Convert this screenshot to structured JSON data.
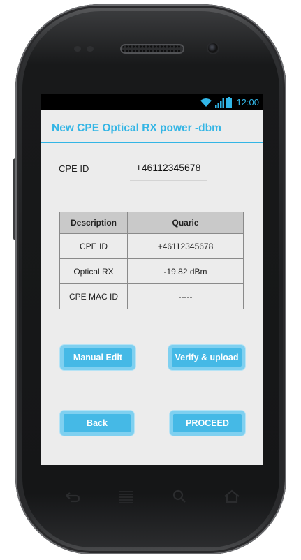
{
  "status_bar": {
    "time": "12:00",
    "icons": [
      "wifi-icon",
      "signal-icon",
      "battery-icon"
    ]
  },
  "app": {
    "title": "New CPE Optical RX power -dbm"
  },
  "form": {
    "cpe_id_label": "CPE ID",
    "cpe_id_value": "+46112345678"
  },
  "table": {
    "headers": [
      "Description",
      "Quarie"
    ],
    "rows": [
      [
        "CPE ID",
        "+46112345678"
      ],
      [
        "Optical RX",
        "-19.82 dBm"
      ],
      [
        "CPE MAC ID",
        "-----"
      ]
    ]
  },
  "buttons": {
    "manual_edit": "Manual Edit",
    "verify_upload": "Verify & upload",
    "back": "Back",
    "proceed": "PROCEED"
  },
  "nav_keys": [
    "back-icon",
    "menu-icon",
    "search-icon",
    "home-icon"
  ],
  "colors": {
    "accent": "#33b5e5",
    "button": "#45b9e6",
    "status_bar": "#000000"
  }
}
